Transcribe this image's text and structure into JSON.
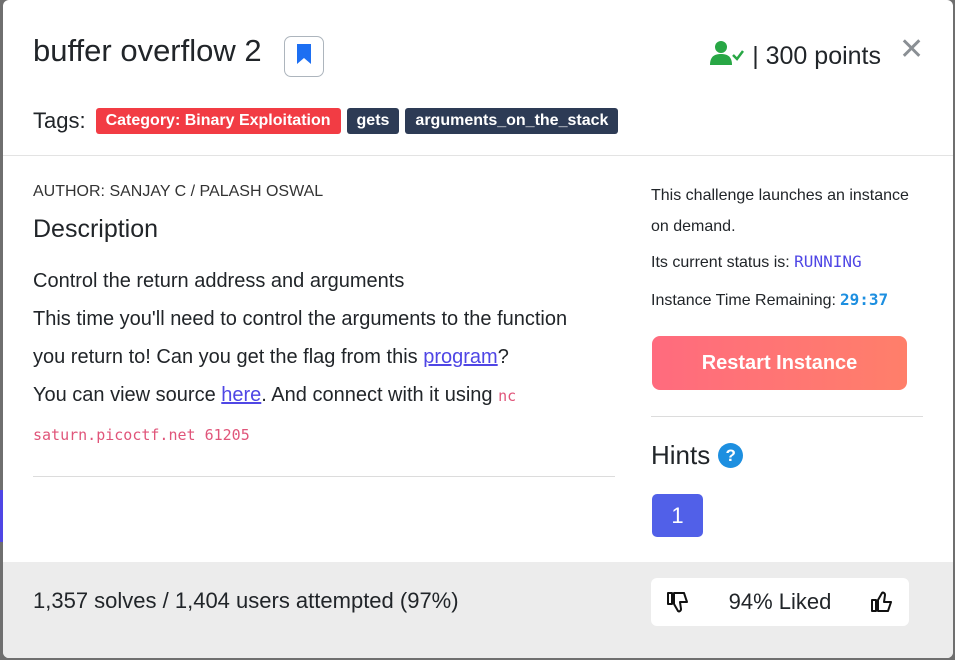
{
  "challenge": {
    "title": "buffer overflow 2",
    "points_label": "| 300 points",
    "tags_label": "Tags:",
    "tags": [
      "Category: Binary Exploitation",
      "gets",
      "arguments_on_the_stack"
    ],
    "author": "AUTHOR: SANJAY C / PALASH OSWAL",
    "description_title": "Description",
    "desc_line1": "Control the return address and arguments",
    "desc_line2": "This time you'll need to control the arguments to the function",
    "desc_line3_a": "you return to! Can you get the flag from this ",
    "desc_link_program": "program",
    "desc_line3_b": "?",
    "desc_line4_a": "You can view source ",
    "desc_link_here": "here",
    "desc_line4_b": ". And connect with it using ",
    "code_nc": "nc",
    "code_host": "saturn.picoctf.net 61205"
  },
  "instance": {
    "launch_text": "This challenge launches an instance on demand.",
    "status_prefix": "Its current status is:",
    "status": "RUNNING",
    "time_label": "Instance Time Remaining:",
    "time_remaining": "29:37",
    "restart_label": "Restart Instance"
  },
  "hints": {
    "title": "Hints",
    "help_symbol": "?",
    "items": [
      "1"
    ]
  },
  "footer": {
    "solves": "1,357 solves / 1,404 users attempted (97%)",
    "liked": "94% Liked"
  },
  "colors": {
    "category_tag": "#f23c44",
    "tag_dark": "#2d3b55",
    "accent": "#4f46e5",
    "timer": "#1d8fe0",
    "solved_icon": "#28a745"
  },
  "icons": [
    "bookmark-icon",
    "user-check-icon",
    "close-icon",
    "help-icon",
    "thumbs-down-icon",
    "thumbs-up-icon"
  ]
}
